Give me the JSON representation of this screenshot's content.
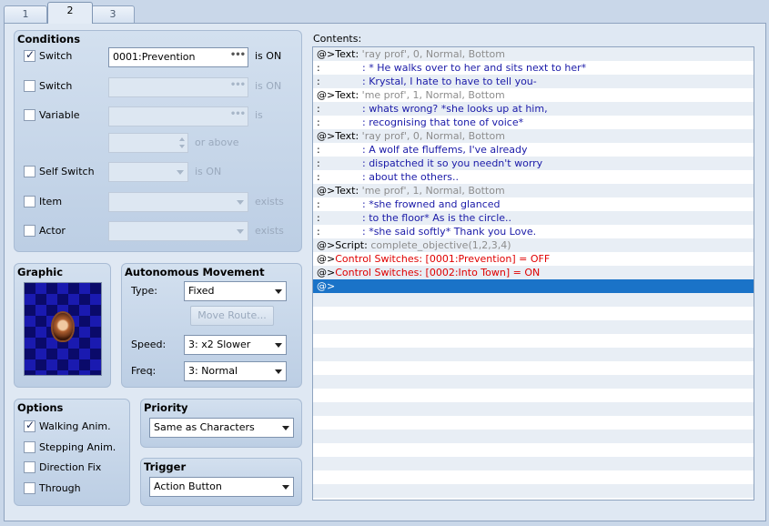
{
  "tabs": [
    "1",
    "2",
    "3"
  ],
  "active_tab": "2",
  "conditions": {
    "title": "Conditions",
    "switch1": {
      "label": "Switch",
      "value": "0001:Prevention",
      "suffix": "is ON",
      "checked": true
    },
    "switch2": {
      "label": "Switch",
      "value": "",
      "suffix": "is ON",
      "checked": false
    },
    "variable": {
      "label": "Variable",
      "value": "",
      "suffix": "is",
      "or_above": "or above",
      "checked": false
    },
    "self_switch": {
      "label": "Self Switch",
      "value": "",
      "suffix": "is ON",
      "checked": false
    },
    "item": {
      "label": "Item",
      "value": "",
      "suffix": "exists",
      "checked": false
    },
    "actor": {
      "label": "Actor",
      "value": "",
      "suffix": "exists",
      "checked": false
    }
  },
  "graphic": {
    "title": "Graphic"
  },
  "movement": {
    "title": "Autonomous Movement",
    "type_label": "Type:",
    "type_value": "Fixed",
    "move_route": "Move Route...",
    "speed_label": "Speed:",
    "speed_value": "3: x2 Slower",
    "freq_label": "Freq:",
    "freq_value": "3: Normal"
  },
  "options": {
    "title": "Options",
    "items": [
      {
        "label": "Walking Anim.",
        "checked": true
      },
      {
        "label": "Stepping Anim.",
        "checked": false
      },
      {
        "label": "Direction Fix",
        "checked": false
      },
      {
        "label": "Through",
        "checked": false
      }
    ]
  },
  "priority": {
    "title": "Priority",
    "value": "Same as Characters"
  },
  "trigger": {
    "title": "Trigger",
    "value": "Action Button"
  },
  "contents": {
    "label": "Contents:",
    "rows": [
      {
        "prefix": "@>Text:",
        "text": "'ray prof', 0, Normal, Bottom",
        "style": "gray"
      },
      {
        "prefix": " :",
        "text": ": * He walks over to her and sits next to her*",
        "style": "blue",
        "cont": true
      },
      {
        "prefix": " :",
        "text": ": Krystal, I hate to have to tell you-",
        "style": "blue",
        "cont": true
      },
      {
        "prefix": "@>Text:",
        "text": "'me prof', 1, Normal, Bottom",
        "style": "gray"
      },
      {
        "prefix": " :",
        "text": ": whats wrong? *she looks up at him,",
        "style": "blue",
        "cont": true
      },
      {
        "prefix": " :",
        "text": ": recognising that tone of voice*",
        "style": "blue",
        "cont": true
      },
      {
        "prefix": "@>Text:",
        "text": "'ray prof', 0, Normal, Bottom",
        "style": "gray"
      },
      {
        "prefix": " :",
        "text": ": A wolf ate fluffems, I've already",
        "style": "blue",
        "cont": true
      },
      {
        "prefix": " :",
        "text": ": dispatched it so you needn't worry",
        "style": "blue",
        "cont": true
      },
      {
        "prefix": " :",
        "text": ": about the others..",
        "style": "blue",
        "cont": true
      },
      {
        "prefix": "@>Text:",
        "text": "'me prof', 1, Normal, Bottom",
        "style": "gray"
      },
      {
        "prefix": " :",
        "text": ": *she frowned and glanced",
        "style": "blue",
        "cont": true
      },
      {
        "prefix": " :",
        "text": ": to the floor* As is the circle..",
        "style": "blue",
        "cont": true
      },
      {
        "prefix": " :",
        "text": ": *she said softly* Thank you Love.",
        "style": "blue",
        "cont": true
      },
      {
        "prefix": "@>Script:",
        "text": "complete_objective(1,2,3,4)",
        "style": "gray"
      },
      {
        "prefix": "@>",
        "text": "Control Switches: [0001:Prevention] = OFF",
        "style": "red"
      },
      {
        "prefix": "@>",
        "text": "Control Switches: [0002:Into Town] = ON",
        "style": "red"
      },
      {
        "prefix": "@>",
        "text": "",
        "style": "sel"
      }
    ]
  },
  "colors": {
    "selection": "#1a73c8",
    "text_blue": "#1a1aa8",
    "command_red": "#e00000"
  }
}
